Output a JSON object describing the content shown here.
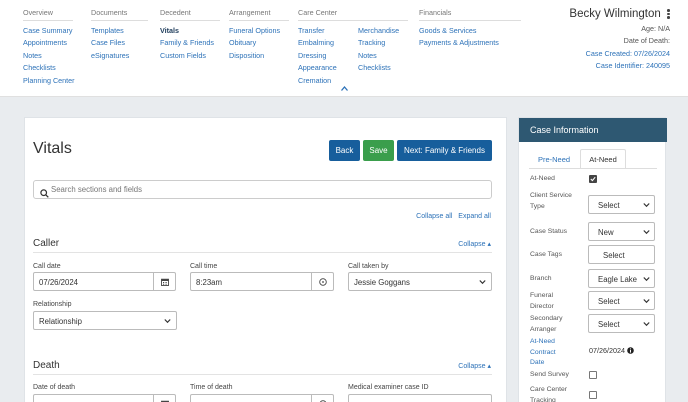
{
  "nav": {
    "overview": {
      "heading": "Overview",
      "links": [
        "Case Summary",
        "Appointments",
        "Notes",
        "Checklists",
        "Planning Center"
      ]
    },
    "documents": {
      "heading": "Documents",
      "links": [
        "Templates",
        "Case Files",
        "eSignatures"
      ]
    },
    "decedent": {
      "heading": "Decedent",
      "links": [
        "Vitals",
        "Family & Friends",
        "Custom Fields"
      ],
      "active": "Vitals"
    },
    "arrangement": {
      "heading": "Arrangement",
      "links": [
        "Funeral Options",
        "Obituary",
        "Disposition"
      ]
    },
    "care_center": {
      "heading": "Care Center",
      "col1": [
        "Transfer",
        "Embalming",
        "Dressing",
        "Appearance",
        "Cremation"
      ],
      "col2": [
        "Merchandise",
        "Tracking",
        "Notes",
        "Checklists"
      ]
    },
    "financials": {
      "heading": "Financials",
      "links": [
        "Goods & Services",
        "Payments & Adjustments"
      ]
    }
  },
  "case": {
    "name": "Becky Wilmington",
    "age_label": "Age:",
    "age": "N/A",
    "dod_label": "Date of Death:",
    "dod": "",
    "created_label": "Case Created:",
    "created": "07/26/2024",
    "identifier_label": "Case Identifier:",
    "identifier": "240095"
  },
  "main": {
    "title": "Vitals",
    "back": "Back",
    "save": "Save",
    "next": "Next: Family & Friends",
    "search_placeholder": "Search sections and fields",
    "collapse_all": "Collapse all",
    "expand_all": "Expand all",
    "caller": {
      "title": "Caller",
      "collapse": "Collapse ▴",
      "call_date_label": "Call date",
      "call_date": "07/26/2024",
      "call_time_label": "Call time",
      "call_time": "8:23am",
      "taken_by_label": "Call taken by",
      "taken_by": "Jessie Goggans",
      "relationship_label": "Relationship",
      "relationship": "Relationship"
    },
    "death": {
      "title": "Death",
      "collapse": "Collapse ▴",
      "date_label": "Date of death",
      "time_label": "Time of death",
      "me_label": "Medical examiner case ID"
    }
  },
  "panel": {
    "title": "Case Information",
    "tabs": [
      "Pre-Need",
      "At-Need"
    ],
    "active_tab": "At-Need",
    "rows": {
      "at_need_label": "At-Need",
      "at_need_checked": true,
      "client_service_type_label": "Client Service Type",
      "client_service_type": "Select",
      "case_status_label": "Case Status",
      "case_status": "New",
      "case_tags_label": "Case Tags",
      "case_tags": "Select",
      "branch_label": "Branch",
      "branch": "Eagle Lake",
      "funeral_director_label": "Funeral Director",
      "funeral_director": "Select",
      "secondary_arranger_label": "Secondary Arranger",
      "secondary_arranger": "Select",
      "contract_date_label": "At-Need Contract Date",
      "contract_date": "07/26/2024",
      "send_survey_label": "Send Survey",
      "send_survey_checked": false,
      "care_center_tracking_label": "Care Center Tracking",
      "care_center_tracking_checked": false
    }
  },
  "colors": {
    "primary": "#175e9c",
    "save": "#3a9e4c",
    "panel_header": "#2e5872",
    "link": "#2d72b8"
  }
}
